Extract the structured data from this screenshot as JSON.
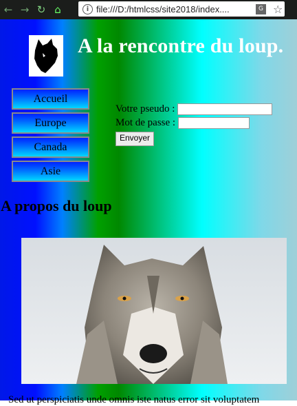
{
  "browser": {
    "url": "file:///D:/htmlcss/site2018/index....",
    "icons": [
      "back-icon",
      "forward-icon",
      "reload-icon",
      "home-icon",
      "info-icon",
      "translate-icon",
      "star-icon"
    ]
  },
  "header": {
    "title": "A la rencontre du loup."
  },
  "menu": {
    "items": [
      {
        "label": "Accueil"
      },
      {
        "label": "Europe"
      },
      {
        "label": "Canada"
      },
      {
        "label": "Asie"
      }
    ]
  },
  "login": {
    "pseudo_label": "Votre pseudo :",
    "password_label": "Mot de passe :",
    "submit_label": "Envoyer"
  },
  "section": {
    "title": "A propos du loup",
    "text": "Sed ut perspiciatis unde omnis iste natus error sit voluptatem"
  }
}
